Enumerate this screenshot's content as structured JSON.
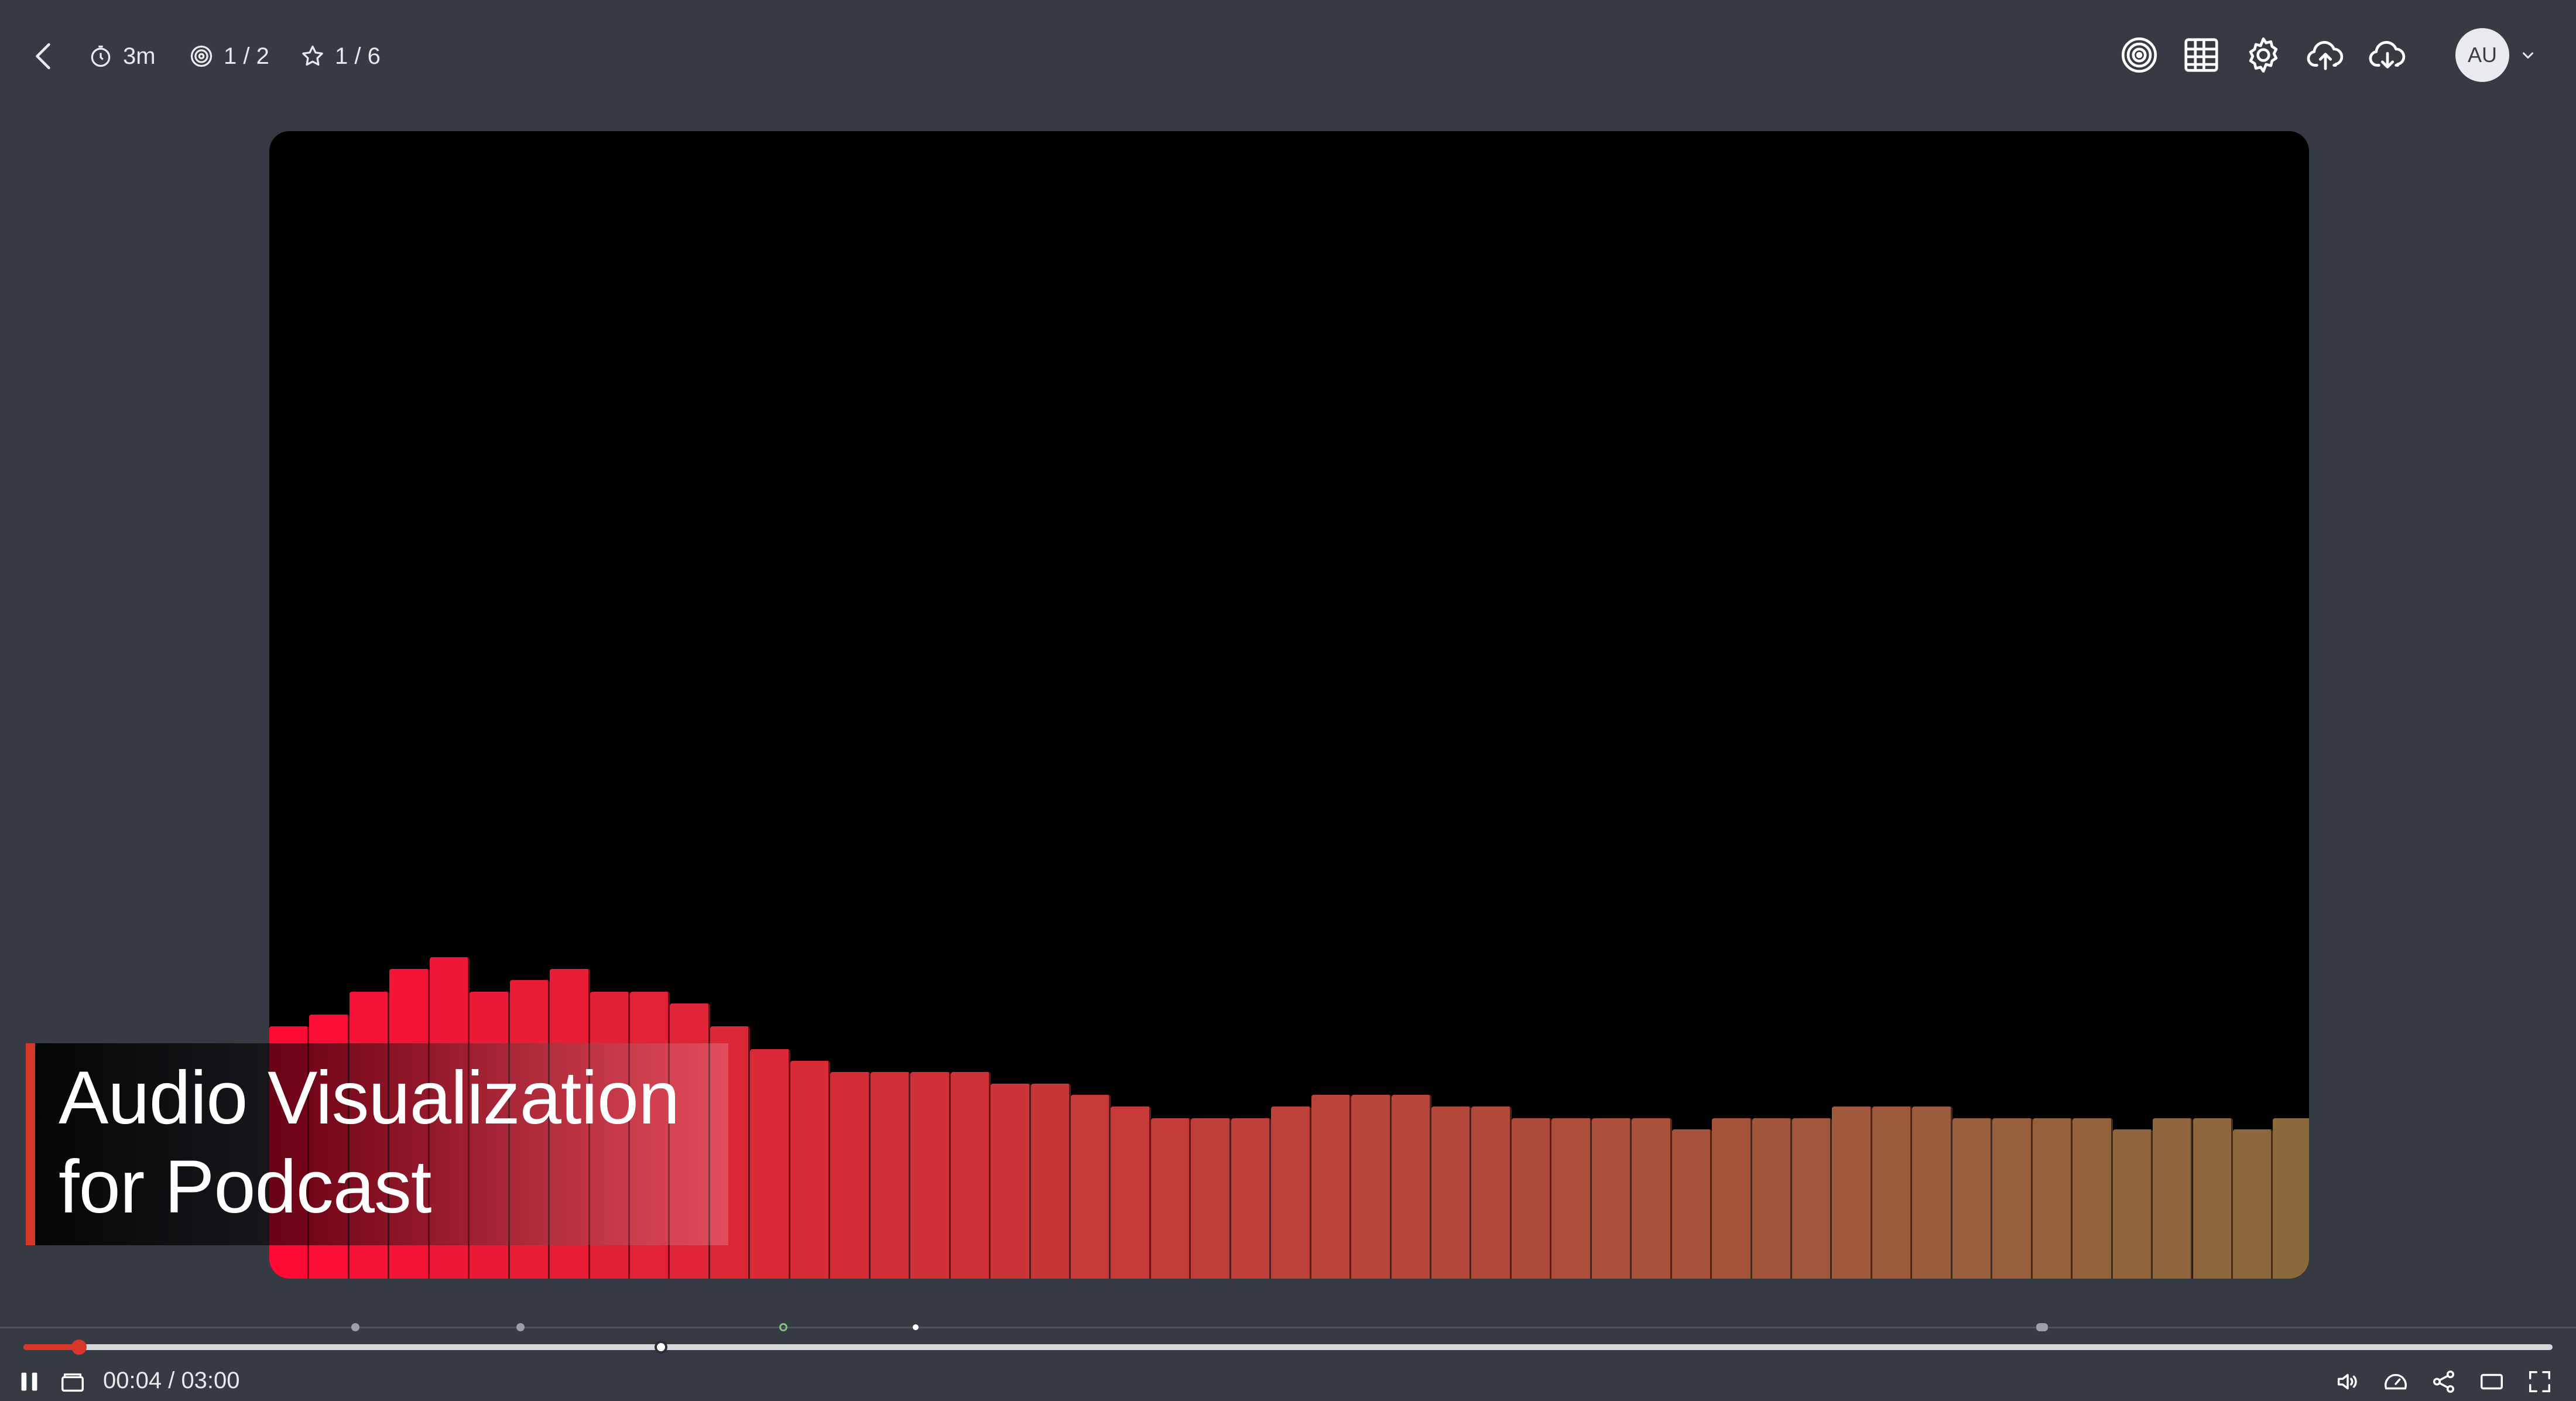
{
  "header": {
    "stats": {
      "duration": "3m",
      "targets": "1 / 2",
      "stars": "1 / 6"
    },
    "user": {
      "initials": "AU"
    },
    "icons": [
      "back-icon",
      "timer-icon",
      "target-icon",
      "star-icon",
      "target-icon",
      "grid-icon",
      "gear-icon",
      "cloud-upload-icon",
      "cloud-download-icon",
      "chevron-down-icon"
    ]
  },
  "overlay": {
    "title_line1": "Audio Visualization",
    "title_line2": "for Podcast"
  },
  "visualizer": {
    "levels": [
      0.22,
      0.23,
      0.25,
      0.27,
      0.28,
      0.25,
      0.26,
      0.27,
      0.25,
      0.25,
      0.24,
      0.22,
      0.2,
      0.19,
      0.18,
      0.18,
      0.18,
      0.18,
      0.17,
      0.17,
      0.16,
      0.15,
      0.14,
      0.14,
      0.14,
      0.15,
      0.16,
      0.16,
      0.16,
      0.15,
      0.15,
      0.14,
      0.14,
      0.14,
      0.14,
      0.13,
      0.14,
      0.14,
      0.14,
      0.15,
      0.15,
      0.15,
      0.14,
      0.14,
      0.14,
      0.14,
      0.13,
      0.14,
      0.14,
      0.13,
      0.14
    ],
    "color_start": "#ff0a35",
    "color_end": "#8a6a3c"
  },
  "player": {
    "current_time": "00:04",
    "total_time": "03:00",
    "timecode": "00:04 / 03:00",
    "progress": 0.022,
    "hover_position": 0.252,
    "markers": [
      {
        "pos": 0.138,
        "style": "dot"
      },
      {
        "pos": 0.202,
        "style": "dot"
      },
      {
        "pos": 0.304,
        "style": "green"
      },
      {
        "pos": 0.356,
        "style": "white"
      },
      {
        "pos": 0.792,
        "style": "pill"
      }
    ],
    "accent_color": "#d7372b"
  }
}
